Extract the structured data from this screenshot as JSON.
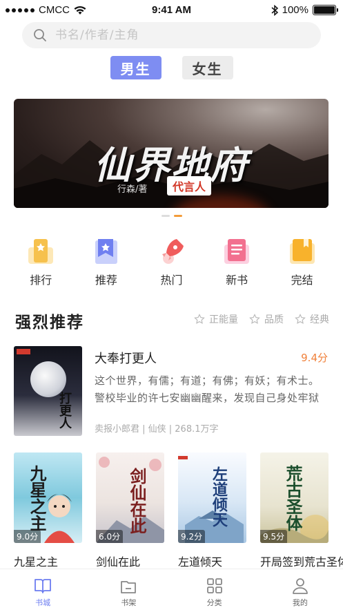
{
  "status_bar": {
    "carrier": "CMCC",
    "time": "9:41 AM",
    "battery": "100%"
  },
  "search": {
    "placeholder": "书名/作者/主角"
  },
  "gender_tabs": [
    {
      "label": "男生",
      "active": true
    },
    {
      "label": "女生",
      "active": false
    }
  ],
  "banner": {
    "title": "仙界地府",
    "author": "行森/著",
    "badge": "代言人",
    "pages": 2,
    "current_page": 2
  },
  "categories": [
    {
      "label": "排行",
      "icon": "ranking-icon"
    },
    {
      "label": "推荐",
      "icon": "recommend-icon"
    },
    {
      "label": "热门",
      "icon": "rocket-icon"
    },
    {
      "label": "新书",
      "icon": "new-book-icon"
    },
    {
      "label": "完结",
      "icon": "finished-icon"
    }
  ],
  "section": {
    "title": "强烈推荐",
    "filters": [
      {
        "label": "正能量"
      },
      {
        "label": "品质"
      },
      {
        "label": "经典"
      }
    ]
  },
  "featured": {
    "name": "大奉打更人",
    "score": "9.4分",
    "description": "这个世界，有儒；有道；有佛；有妖；有术士。警校毕业的许七安幽幽醒来，发现自己身处牢狱之中。",
    "meta": "卖报小郎君 | 仙侠 | 268.1万字",
    "cover_title": "打更人"
  },
  "books": [
    {
      "name": "九星之主",
      "score": "9.0分",
      "cover_title": "九星之主"
    },
    {
      "name": "剑仙在此",
      "score": "6.0分",
      "cover_title": "剑仙在此"
    },
    {
      "name": "左道倾天",
      "score": "9.2分",
      "cover_title": "左道倾天"
    },
    {
      "name": "开局签到荒古圣体",
      "score": "9.5分",
      "cover_title": "荒古圣体"
    }
  ],
  "tab_bar": [
    {
      "label": "书城",
      "icon": "book-open-icon",
      "active": true
    },
    {
      "label": "书架",
      "icon": "bookshelf-icon",
      "active": false
    },
    {
      "label": "分类",
      "icon": "category-grid-icon",
      "active": false
    },
    {
      "label": "我的",
      "icon": "profile-icon",
      "active": false
    }
  ],
  "colors": {
    "accent": "#7e8df2",
    "score": "#f0803a",
    "tab_active": "#6b7cf0"
  }
}
